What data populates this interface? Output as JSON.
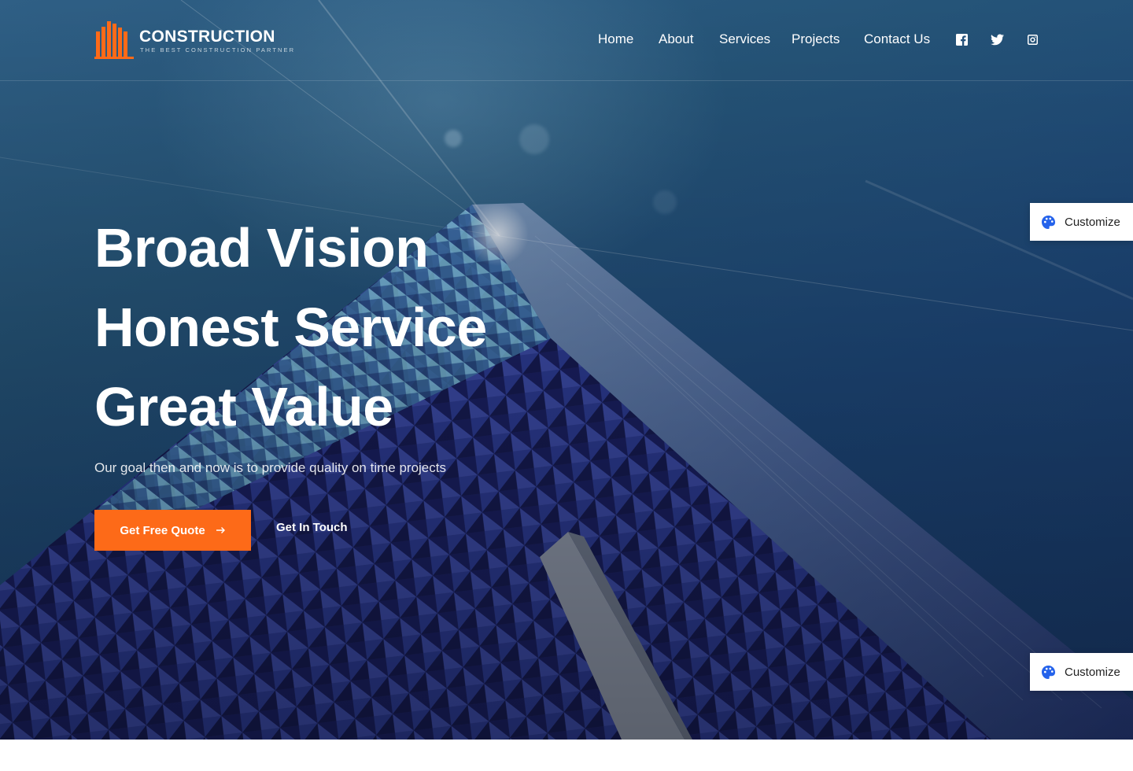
{
  "brand": {
    "title": "CONSTRUCTION",
    "tagline": "THE BEST CONSTRUCTION PARTNER",
    "icon": "building-logo-icon",
    "accent_color": "#fd6a18"
  },
  "nav": {
    "items": [
      {
        "label": "Home"
      },
      {
        "label": "About"
      },
      {
        "label": "Services"
      },
      {
        "label": "Projects"
      },
      {
        "label": "Contact Us"
      }
    ],
    "social": [
      "facebook-icon",
      "twitter-icon",
      "instagram-icon"
    ]
  },
  "hero": {
    "headline": [
      "Broad Vision",
      "Honest Service",
      "Great Value"
    ],
    "subtitle": "Our goal then and now is to provide quality on time projects",
    "primary_button": "Get Free Quote",
    "primary_button_icon": "arrow-right-icon",
    "secondary_button": "Get In Touch"
  },
  "customize_widget": {
    "label": "Customize",
    "icon": "palette-icon",
    "icon_color": "#2563eb"
  }
}
